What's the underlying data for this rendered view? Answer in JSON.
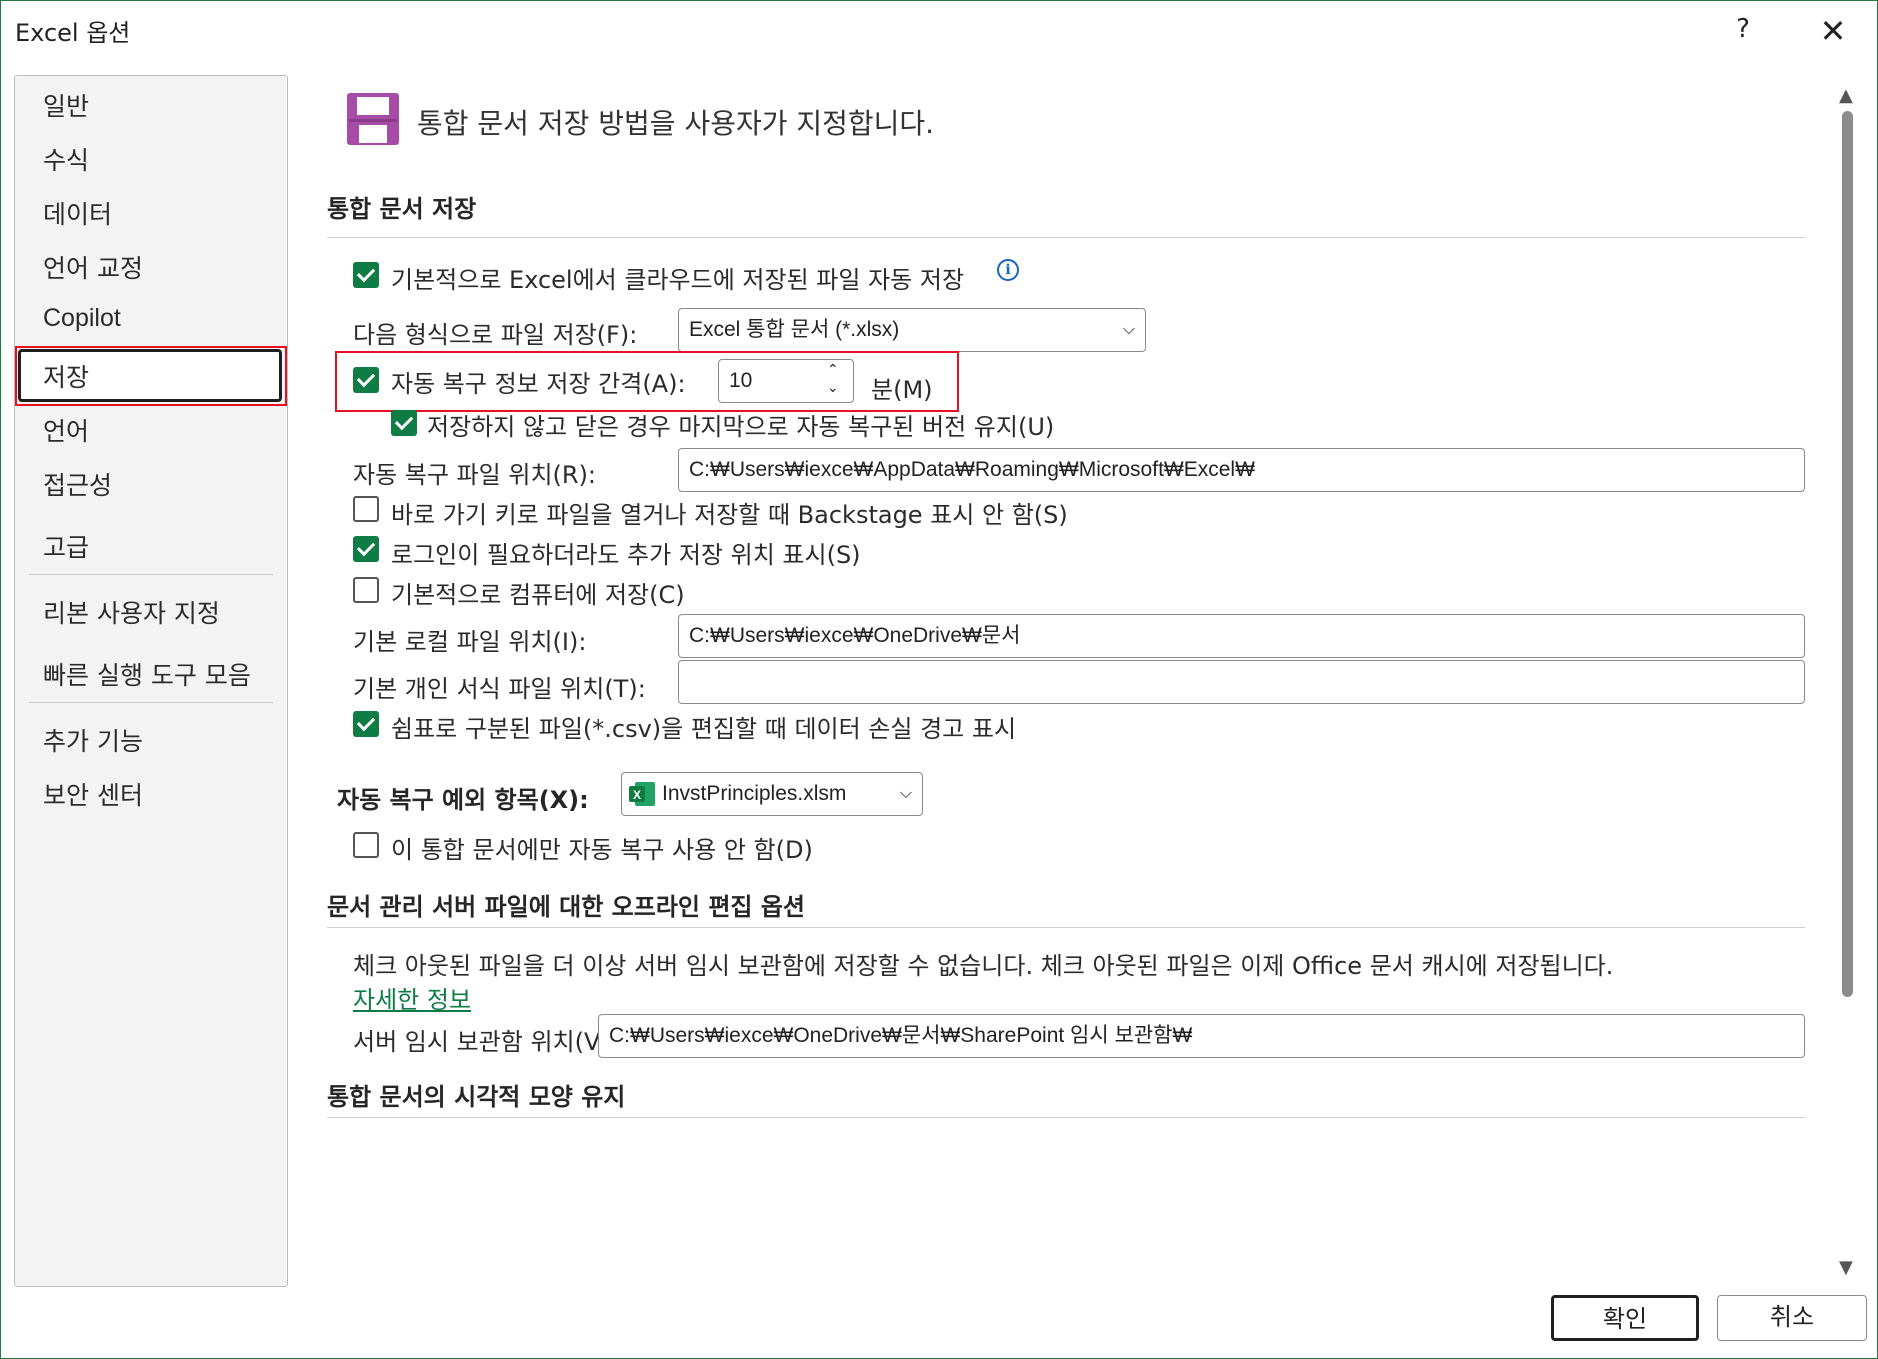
{
  "window": {
    "title": "Excel 옵션",
    "help": "?",
    "close": "✕"
  },
  "sidebar": {
    "items": [
      {
        "label": "일반"
      },
      {
        "label": "수식"
      },
      {
        "label": "데이터"
      },
      {
        "label": "언어 교정"
      },
      {
        "label": "Copilot"
      },
      {
        "label": "저장",
        "selected": true
      },
      {
        "label": "언어"
      },
      {
        "label": "접근성"
      },
      {
        "label": "고급"
      },
      {
        "label": "리본 사용자 지정"
      },
      {
        "label": "빠른 실행 도구 모음"
      },
      {
        "label": "추가 기능"
      },
      {
        "label": "보안 센터"
      }
    ]
  },
  "header": {
    "icon": "save-icon",
    "text": "통합 문서 저장 방법을 사용자가 지정합니다."
  },
  "save_section": {
    "title": "통합 문서 저장",
    "autosave_cloud": {
      "label": "기본적으로 Excel에서 클라우드에 저장된 파일 자동 저장",
      "checked": true
    },
    "save_format": {
      "label": "다음 형식으로 파일 저장(F):",
      "value": "Excel 통합 문서 (*.xlsx)"
    },
    "autorecover_interval": {
      "label": "자동 복구 정보 저장 간격(A):",
      "checked": true,
      "value": "10",
      "unit": "분(M)"
    },
    "keep_last_version": {
      "label": "저장하지 않고 닫은 경우 마지막으로 자동 복구된 버전 유지(U)",
      "checked": true
    },
    "autorecover_location": {
      "label": "자동 복구 파일 위치(R):",
      "value": "C:₩Users₩iexce₩AppData₩Roaming₩Microsoft₩Excel₩"
    },
    "backstage": {
      "label": "바로 가기 키로 파일을 열거나 저장할 때 Backstage 표시 안 함(S)",
      "checked": false
    },
    "show_additional": {
      "label": "로그인이 필요하더라도 추가 저장 위치 표시(S)",
      "checked": true
    },
    "save_to_computer": {
      "label": "기본적으로 컴퓨터에 저장(C)",
      "checked": false
    },
    "default_local": {
      "label": "기본 로컬 파일 위치(I):",
      "value": "C:₩Users₩iexce₩OneDrive₩문서"
    },
    "personal_templates": {
      "label": "기본 개인 서식 파일 위치(T):",
      "value": ""
    },
    "csv_warning": {
      "label": "쉼표로 구분된 파일(*.csv)을 편집할 때 데이터 손실 경고 표시",
      "checked": true
    }
  },
  "exceptions": {
    "label": "자동 복구 예외 항목(X):",
    "workbook": "InvstPrinciples.xlsm",
    "disable": {
      "label": "이 통합 문서에만 자동 복구 사용 안 함(D)",
      "checked": false
    }
  },
  "offline": {
    "title": "문서 관리 서버 파일에 대한 오프라인 편집 옵션",
    "note": "체크 아웃된 파일을 더 이상 서버 임시 보관함에 저장할 수 없습니다. 체크 아웃된 파일은 이제 Office 문서 캐시에 저장됩니다.",
    "link": "자세한 정보",
    "drafts": {
      "label": "서버 임시 보관함 위치(V):",
      "value": "C:₩Users₩iexce₩OneDrive₩문서₩SharePoint 임시 보관함₩"
    }
  },
  "visual": {
    "title": "통합 문서의 시각적 모양 유지"
  },
  "buttons": {
    "ok": "확인",
    "cancel": "취소"
  },
  "colors": {
    "accent": "#0f7b45",
    "highlight": "#e81123",
    "icon": "#a64ca6"
  }
}
